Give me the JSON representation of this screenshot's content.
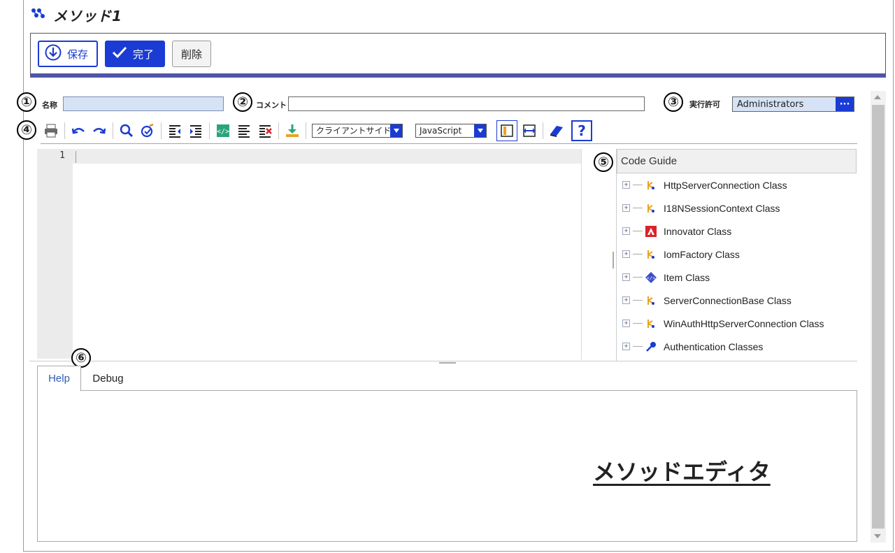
{
  "window": {
    "title": "メソッド1",
    "title_icon": "method-network-icon"
  },
  "toolbar": {
    "save_label": "保存",
    "done_label": "完了",
    "delete_label": "削除"
  },
  "callouts": [
    "①",
    "②",
    "③",
    "④",
    "⑤",
    "⑥"
  ],
  "form": {
    "name_label": "名称",
    "name_value": "",
    "comment_label": "コメント",
    "comment_value": "",
    "permission_label": "実行許可",
    "permission_value": "Administrators",
    "permission_button": "···"
  },
  "editor_toolbar": {
    "icons": [
      "print-icon",
      "undo-icon",
      "redo-icon",
      "search-icon",
      "spellcheck-icon",
      "outdent-icon",
      "indent-icon",
      "code-icon",
      "align-icon",
      "clear-format-icon",
      "download-icon",
      "dock-panel-icon",
      "swap-icon",
      "book-icon",
      "help-icon"
    ],
    "location_select": "クライアントサイド",
    "language_select": "JavaScript",
    "help_label": "?"
  },
  "editor": {
    "line_numbers": [
      "1"
    ]
  },
  "code_guide": {
    "title": "Code Guide",
    "items": [
      {
        "label": "HttpServerConnection Class",
        "icon": "class-icon"
      },
      {
        "label": "I18NSessionContext Class",
        "icon": "class-icon"
      },
      {
        "label": "Innovator Class",
        "icon": "innovator-icon"
      },
      {
        "label": "IomFactory Class",
        "icon": "class-icon"
      },
      {
        "label": "Item Class",
        "icon": "item-icon"
      },
      {
        "label": "ServerConnectionBase Class",
        "icon": "class-icon"
      },
      {
        "label": "WinAuthHttpServerConnection Class",
        "icon": "class-icon"
      },
      {
        "label": "Authentication Classes",
        "icon": "key-icon"
      }
    ]
  },
  "bottom_tabs": [
    "Help",
    "Debug"
  ],
  "caption": "メソッドエディタ",
  "colors": {
    "accent": "#1a3cd4",
    "band": "#4f54a8",
    "name_field_bg": "#d6e2f5"
  }
}
